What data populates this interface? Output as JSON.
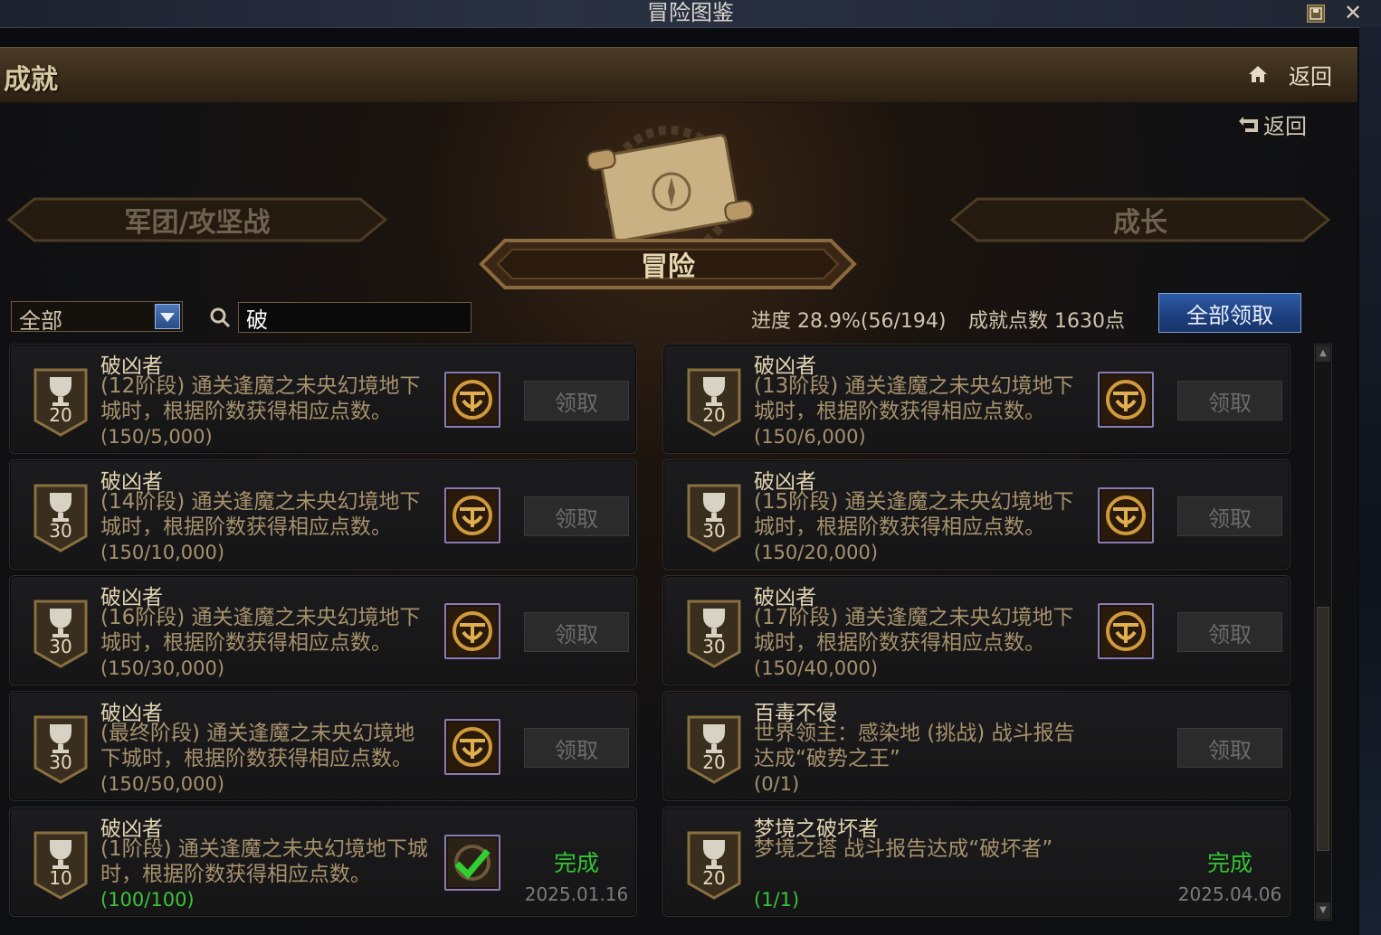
{
  "window": {
    "title": "冒险图鉴"
  },
  "header": {
    "title": "成就",
    "back_label": "返回"
  },
  "sub_back_label": "返回",
  "categories": {
    "left": "军团/攻坚战",
    "center": "冒险",
    "right": "成长"
  },
  "filter": {
    "selected": "全部",
    "search_value": "破"
  },
  "progress": "进度 28.9%(56/194)",
  "points": "成就点数 1630点",
  "claim_all_label": "全部领取",
  "cards": [
    {
      "points": "20",
      "title": "破凶者",
      "desc": "(12阶段) 通关逢魔之未央幻境地下城时，根据阶数获得相应点数。",
      "progress": "(150/5,000)",
      "action": "领取"
    },
    {
      "points": "20",
      "title": "破凶者",
      "desc": "(13阶段) 通关逢魔之未央幻境地下城时，根据阶数获得相应点数。",
      "progress": "(150/6,000)",
      "action": "领取"
    },
    {
      "points": "30",
      "title": "破凶者",
      "desc": "(14阶段) 通关逢魔之未央幻境地下城时，根据阶数获得相应点数。",
      "progress": "(150/10,000)",
      "action": "领取"
    },
    {
      "points": "30",
      "title": "破凶者",
      "desc": "(15阶段) 通关逢魔之未央幻境地下城时，根据阶数获得相应点数。",
      "progress": "(150/20,000)",
      "action": "领取"
    },
    {
      "points": "30",
      "title": "破凶者",
      "desc": "(16阶段) 通关逢魔之未央幻境地下城时，根据阶数获得相应点数。",
      "progress": "(150/30,000)",
      "action": "领取"
    },
    {
      "points": "30",
      "title": "破凶者",
      "desc": "(17阶段) 通关逢魔之未央幻境地下城时，根据阶数获得相应点数。",
      "progress": "(150/40,000)",
      "action": "领取"
    },
    {
      "points": "30",
      "title": "破凶者",
      "desc": "(最终阶段) 通关逢魔之未央幻境地下城时，根据阶数获得相应点数。",
      "progress": "(150/50,000)",
      "action": "领取"
    },
    {
      "points": "20",
      "title": "百毒不侵",
      "desc": "世界领主：感染地 (挑战) 战斗报告达成“破势之王”",
      "progress": "(0/1)",
      "action": "领取"
    },
    {
      "points": "10",
      "title": "破凶者",
      "desc": "(1阶段) 通关逢魔之未央幻境地下城时，根据阶数获得相应点数。",
      "progress": "(100/100)",
      "done": "完成",
      "date": "2025.01.16"
    },
    {
      "points": "20",
      "title": "梦境之破坏者",
      "desc": "梦境之塔 战斗报告达成“破坏者”",
      "progress": "(1/1)",
      "done": "完成",
      "date": "2025.04.06"
    }
  ],
  "colors": {
    "accent": "#2d5aa6",
    "done_green": "#33c233",
    "gold_text": "#e2d4b0"
  }
}
